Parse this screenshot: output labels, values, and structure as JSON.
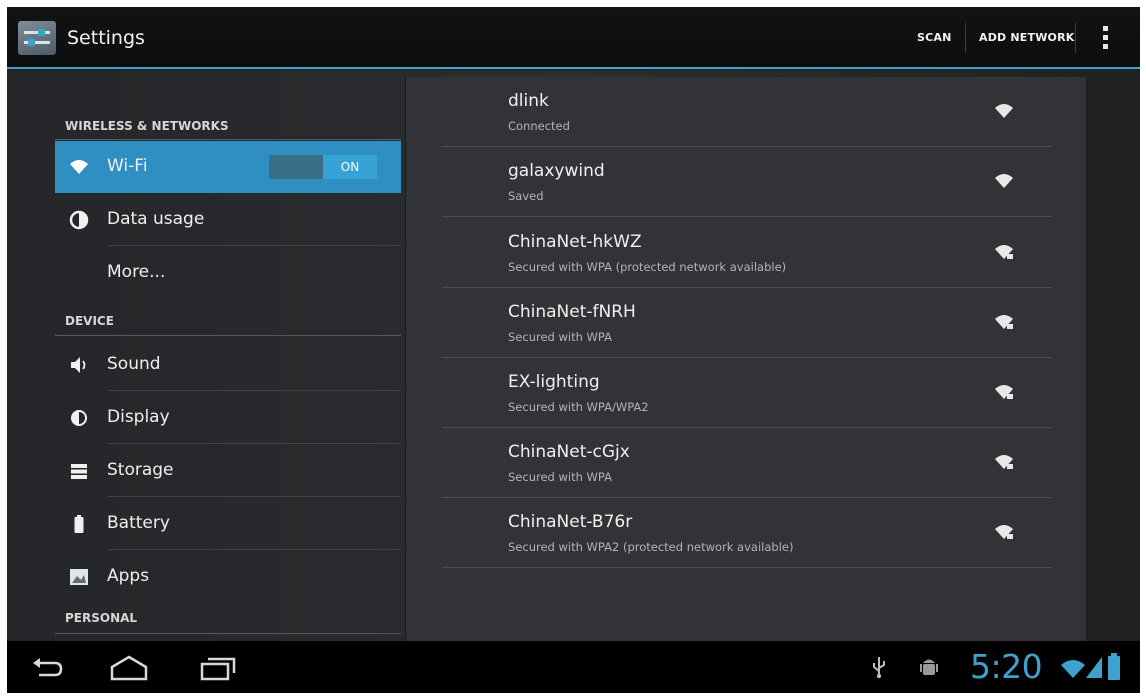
{
  "app": {
    "title": "Settings",
    "icon": "settings-app-icon"
  },
  "actionbar": {
    "scan_label": "SCAN",
    "add_network_label": "ADD NETWORK",
    "overflow_icon": "overflow-menu-icon"
  },
  "sidebar": {
    "sections": {
      "wireless": "WIRELESS & NETWORKS",
      "device": "DEVICE",
      "personal": "PERSONAL"
    },
    "items": {
      "wifi": {
        "label": "Wi-Fi",
        "icon": "wifi-icon",
        "selected": true,
        "toggle": "ON"
      },
      "data_usage": {
        "label": "Data usage",
        "icon": "data-usage-icon"
      },
      "more": {
        "label": "More..."
      },
      "sound": {
        "label": "Sound",
        "icon": "sound-icon"
      },
      "display": {
        "label": "Display",
        "icon": "display-icon"
      },
      "storage": {
        "label": "Storage",
        "icon": "storage-icon"
      },
      "battery": {
        "label": "Battery",
        "icon": "battery-icon"
      },
      "apps": {
        "label": "Apps",
        "icon": "apps-icon"
      }
    }
  },
  "networks": [
    {
      "ssid": "dlink",
      "status": "Connected",
      "secured": false
    },
    {
      "ssid": "galaxywind",
      "status": "Saved",
      "secured": false
    },
    {
      "ssid": "ChinaNet-hkWZ",
      "status": "Secured with WPA (protected network available)",
      "secured": true
    },
    {
      "ssid": "ChinaNet-fNRH",
      "status": "Secured with WPA",
      "secured": true
    },
    {
      "ssid": "EX-lighting",
      "status": "Secured with WPA/WPA2",
      "secured": true
    },
    {
      "ssid": "ChinaNet-cGjx",
      "status": "Secured with WPA",
      "secured": true
    },
    {
      "ssid": "ChinaNet-B76r",
      "status": "Secured with WPA2 (protected network available)",
      "secured": true
    }
  ],
  "navbar": {
    "back_icon": "back-icon",
    "home_icon": "home-icon",
    "recents_icon": "recent-apps-icon",
    "usb_icon": "usb-icon",
    "debug_icon": "android-debug-icon",
    "time": "5:20",
    "wifi_status_icon": "wifi-status-icon",
    "signal_icon": "signal-icon",
    "battery_icon": "battery-status-icon"
  },
  "colors": {
    "accent": "#3ea3cc",
    "selected_item": "#2f8fc2",
    "background": "#222427"
  }
}
